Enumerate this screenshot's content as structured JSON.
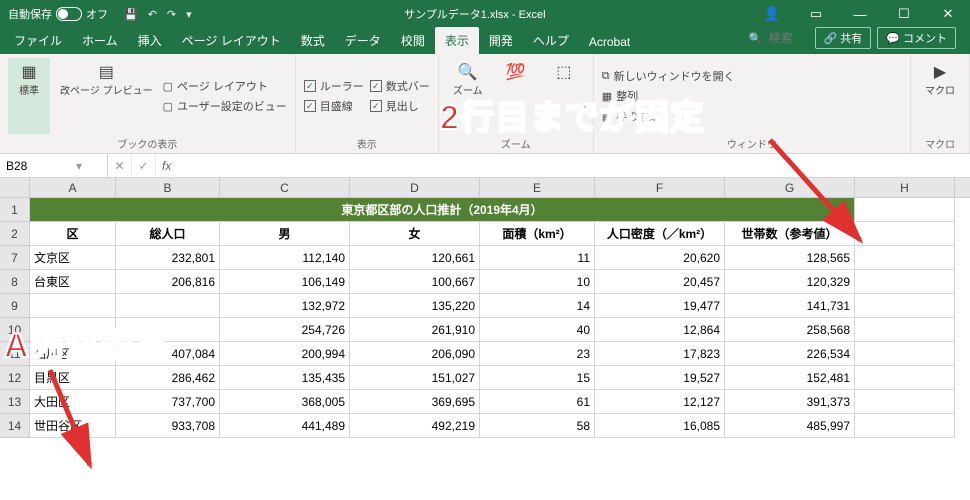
{
  "titlebar": {
    "autosave": "自動保存",
    "autosave_state": "オフ",
    "filename": "サンプルデータ1.xlsx - Excel"
  },
  "tabs": {
    "items": [
      "ファイル",
      "ホーム",
      "挿入",
      "ページ レイアウト",
      "数式",
      "データ",
      "校閲",
      "表示",
      "開発",
      "ヘルプ",
      "Acrobat"
    ],
    "active": 7,
    "search_placeholder": "検索",
    "share": "共有",
    "comment": "コメント"
  },
  "ribbon": {
    "group1_label": "ブックの表示",
    "standard": "標準",
    "pagebreak": "改ページ\nプレビュー",
    "pagelayout": "ページ レイアウト",
    "userview": "ユーザー設定のビュー",
    "group2_label": "表示",
    "ruler": "ルーラー",
    "formulabar": "数式バー",
    "gridlines": "目盛線",
    "headings": "見出し",
    "group3_label": "ズーム",
    "zoom": "ズーム",
    "group_window_label": "ウィンドウ",
    "new_window": "新しいウィンドウを開く",
    "arrange": "整列",
    "freeze": "枠の固定",
    "group_macro_label": "マクロ",
    "macro": "マクロ"
  },
  "namebox": "B28",
  "columns": [
    "A",
    "B",
    "C",
    "D",
    "E",
    "F",
    "G",
    "H"
  ],
  "sheet_title": "東京都区部の人口推計（2019年4月）",
  "headers": [
    "区",
    "総人口",
    "男",
    "女",
    "面積（km²）",
    "人口密度（／km²）",
    "世帯数（参考値）"
  ],
  "row_numbers": [
    7,
    8,
    9,
    10,
    11,
    12,
    13,
    14
  ],
  "data": [
    [
      "文京区",
      "232,801",
      "112,140",
      "120,661",
      "11",
      "20,620",
      "128,565"
    ],
    [
      "台東区",
      "206,816",
      "106,149",
      "100,667",
      "10",
      "20,457",
      "120,329"
    ],
    [
      "",
      "",
      "132,972",
      "135,220",
      "14",
      "19,477",
      "141,731"
    ],
    [
      "",
      "",
      "254,726",
      "261,910",
      "40",
      "12,864",
      "258,568"
    ],
    [
      "品川区",
      "407,084",
      "200,994",
      "206,090",
      "23",
      "17,823",
      "226,534"
    ],
    [
      "目黒区",
      "286,462",
      "135,435",
      "151,027",
      "15",
      "19,527",
      "152,481"
    ],
    [
      "大田区",
      "737,700",
      "368,005",
      "369,695",
      "61",
      "12,127",
      "391,373"
    ],
    [
      "世田谷区",
      "933,708",
      "441,489",
      "492,219",
      "58",
      "16,085",
      "485,997"
    ]
  ],
  "annotations": {
    "top": "2行目までが固定",
    "left": "A列が固定"
  }
}
